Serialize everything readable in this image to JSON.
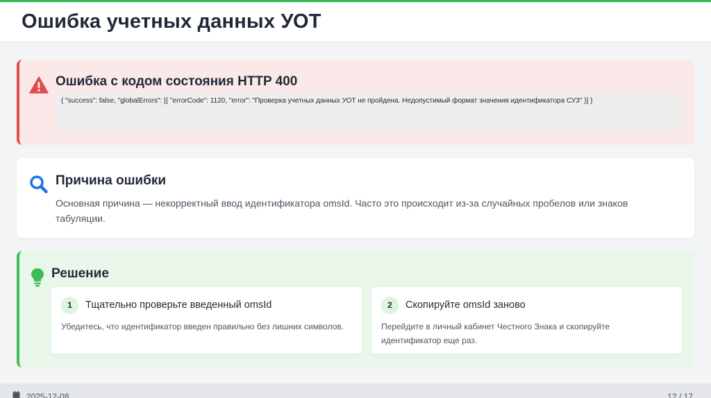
{
  "header": {
    "title": "Ошибка учетных данных УОТ"
  },
  "error_card": {
    "icon": "warning-triangle-icon",
    "title": "Ошибка с кодом состояния HTTP 400",
    "code": "{ \"success\": false, \"globalErrors\": [{ \"errorCode\": 1120, \"error\": \"Проверка учетных данных УОТ не пройдена. Недопустимый формат значения идентификатора СУЗ\" }] }"
  },
  "reason_card": {
    "icon": "magnifier-icon",
    "title": "Причина ошибки",
    "text": "Основная причина — некорректный ввод идентификатора omsId. Часто это происходит из-за случайных пробелов или знаков табуляции."
  },
  "solution_card": {
    "icon": "lightbulb-icon",
    "title": "Решение",
    "steps": [
      {
        "number": "1",
        "title": "Тщательно проверьте введенный omsId",
        "text": "Убедитесь, что идентификатор введен правильно без лишних символов."
      },
      {
        "number": "2",
        "title": "Скопируйте omsId заново",
        "text": "Перейдите в личный кабинет Честного Знака и скопируйте идентификатор еще раз."
      }
    ]
  },
  "footer": {
    "icon": "calendar-icon",
    "date": "2025-12-08",
    "page": "12 / 17"
  },
  "colors": {
    "accent": "#34b84f",
    "error": "#e24b4b",
    "info": "#1a73e8",
    "success": "#3dbb55"
  }
}
